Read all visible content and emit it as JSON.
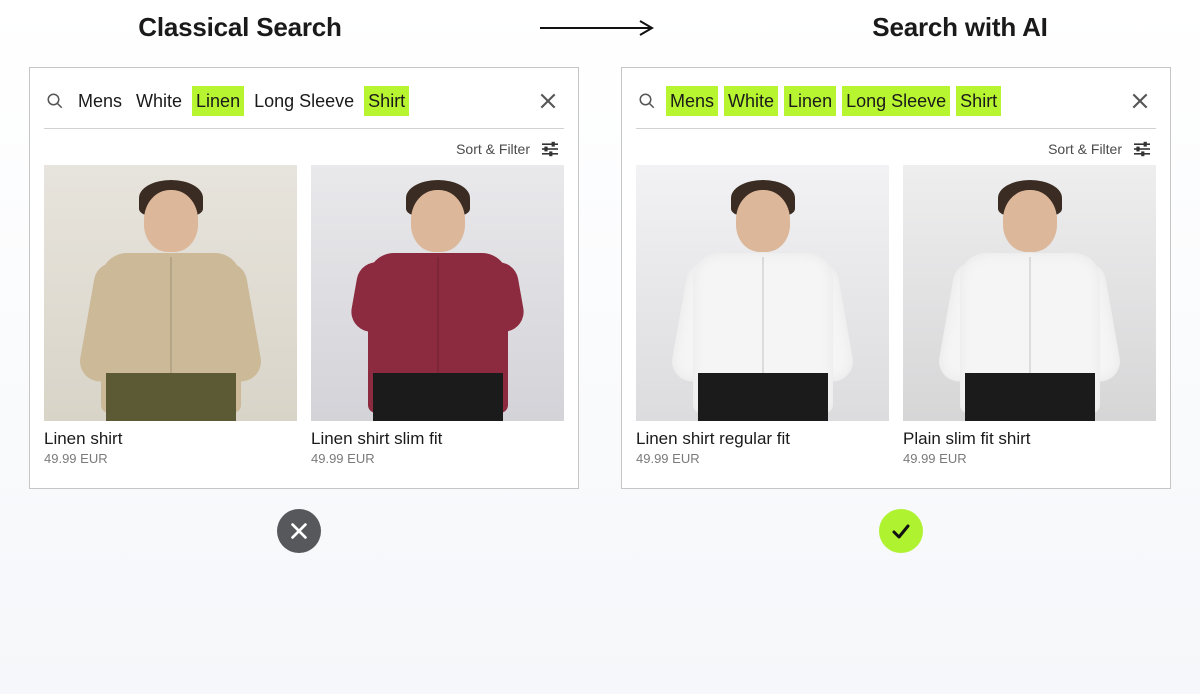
{
  "headings": {
    "left": "Classical Search",
    "right": "Search with AI"
  },
  "sort_filter_label": "Sort & Filter",
  "left_panel": {
    "query_tokens": [
      {
        "t": "Mens",
        "hl": false
      },
      {
        "t": "White",
        "hl": false
      },
      {
        "t": "Linen",
        "hl": true
      },
      {
        "t": "Long Sleeve",
        "hl": false
      },
      {
        "t": "Shirt",
        "hl": true
      }
    ],
    "results": [
      {
        "title": "Linen shirt",
        "price": "49.99 EUR"
      },
      {
        "title": "Linen shirt slim fit",
        "price": "49.99 EUR"
      }
    ],
    "verdict": "fail"
  },
  "right_panel": {
    "query_tokens": [
      {
        "t": "Mens",
        "hl": true
      },
      {
        "t": "White",
        "hl": true
      },
      {
        "t": "Linen",
        "hl": true
      },
      {
        "t": "Long Sleeve",
        "hl": true
      },
      {
        "t": "Shirt",
        "hl": true
      }
    ],
    "results": [
      {
        "title": "Linen shirt regular fit",
        "price": "49.99 EUR"
      },
      {
        "title": "Plain slim fit shirt",
        "price": "49.99 EUR"
      }
    ],
    "verdict": "pass"
  },
  "colors": {
    "highlight": "#b8f531",
    "fail_badge": "#56585c",
    "pass_badge": "#aef230"
  }
}
